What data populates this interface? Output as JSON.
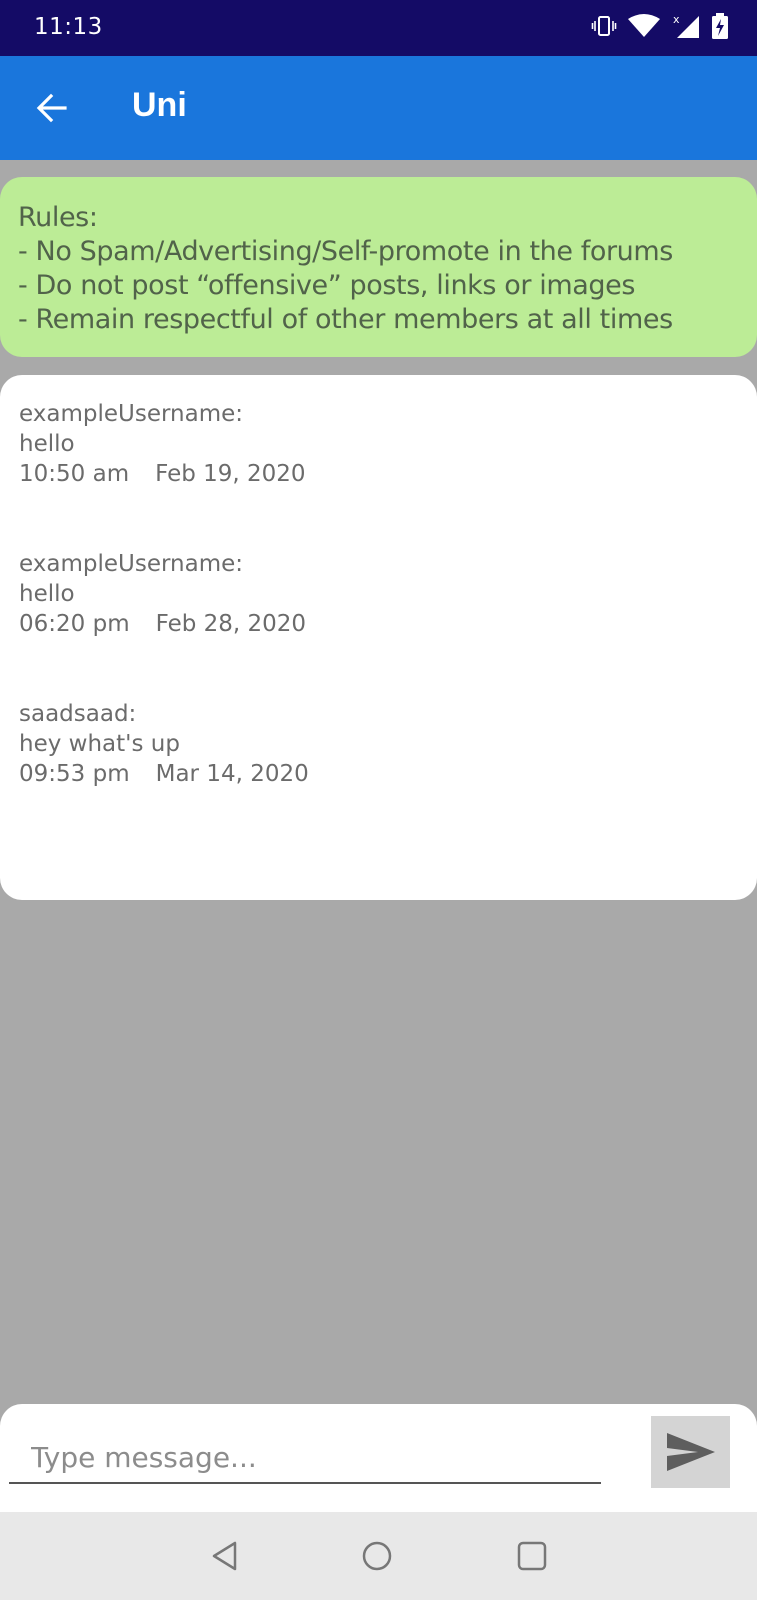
{
  "status_bar": {
    "time": "11:13",
    "icons": [
      "vibrate-icon",
      "wifi-icon",
      "signal-icon",
      "battery-charging-icon"
    ]
  },
  "app_bar": {
    "title": "Uni",
    "back_icon": "arrow-left-icon",
    "color": "#1a76dc"
  },
  "rules": {
    "lines": [
      "Rules:",
      "- No Spam/Advertising/Self-promote in the forums",
      "- Do not post “offensive” posts, links or images",
      "- Remain respectful of other members at all times"
    ],
    "background": "#bcec96"
  },
  "messages": [
    {
      "author": "exampleUsername:",
      "text": "hello",
      "time": "10:50 am",
      "date": "Feb 19, 2020"
    },
    {
      "author": "exampleUsername:",
      "text": "hello",
      "time": "06:20 pm",
      "date": "Feb 28, 2020"
    },
    {
      "author": "saadsaad:",
      "text": "hey what's up",
      "time": "09:53 pm",
      "date": "Mar 14, 2020"
    }
  ],
  "composer": {
    "placeholder": "Type message...",
    "value": "",
    "send_icon": "send-icon"
  },
  "nav_bar": {
    "buttons": [
      "back-nav-icon",
      "home-nav-icon",
      "recents-nav-icon"
    ]
  }
}
